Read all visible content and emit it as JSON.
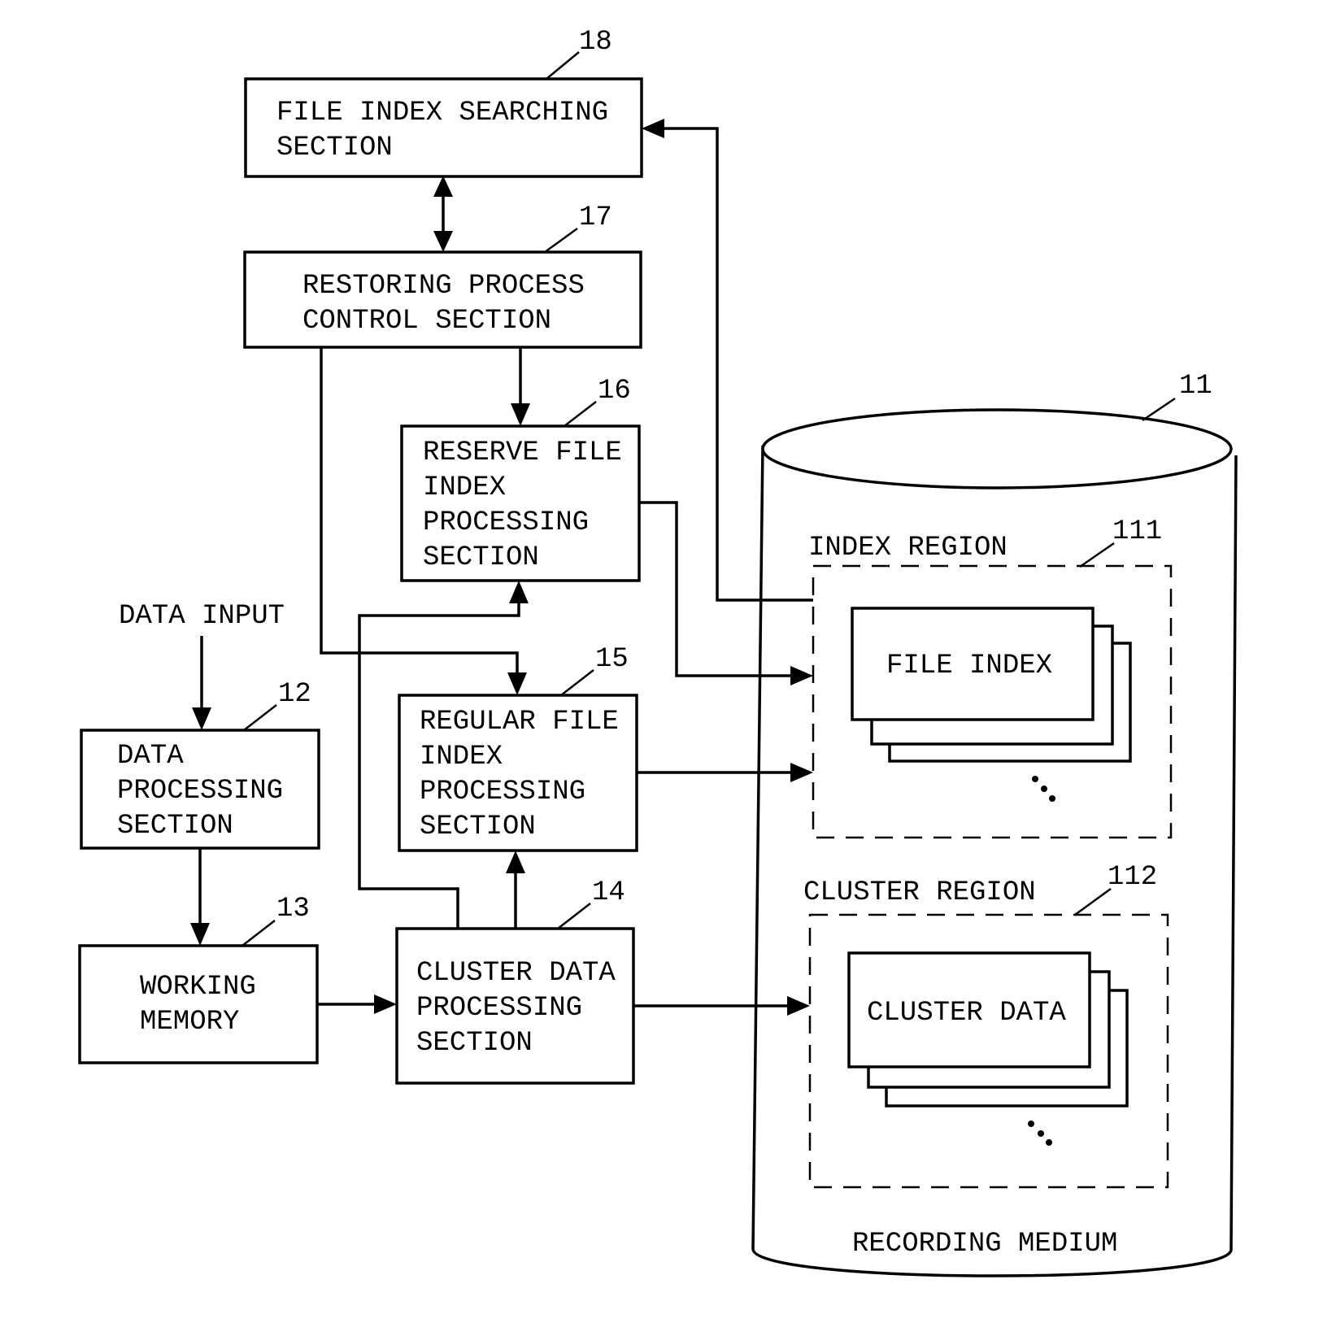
{
  "diagram": {
    "blocks": {
      "file_index_searching": {
        "ref": "18",
        "lines": [
          "FILE INDEX SEARCHING",
          "SECTION"
        ]
      },
      "restoring_process_control": {
        "ref": "17",
        "lines": [
          "RESTORING PROCESS",
          "CONTROL SECTION"
        ]
      },
      "reserve_file_index_processing": {
        "ref": "16",
        "lines": [
          "RESERVE FILE",
          "INDEX",
          "PROCESSING",
          "SECTION"
        ]
      },
      "regular_file_index_processing": {
        "ref": "15",
        "lines": [
          "REGULAR FILE",
          "INDEX",
          "PROCESSING",
          "SECTION"
        ]
      },
      "cluster_data_processing": {
        "ref": "14",
        "lines": [
          "CLUSTER DATA",
          "PROCESSING",
          "SECTION"
        ]
      },
      "data_processing": {
        "ref": "12",
        "lines": [
          "DATA",
          "PROCESSING",
          "SECTION"
        ]
      },
      "working_memory": {
        "ref": "13",
        "lines": [
          "WORKING",
          "MEMORY"
        ]
      }
    },
    "data_input_label": "DATA INPUT",
    "recording_medium": {
      "ref": "11",
      "label": "RECORDING MEDIUM",
      "index_region": {
        "ref": "111",
        "label": "INDEX REGION",
        "item": "FILE INDEX",
        "ellipsis": "..."
      },
      "cluster_region": {
        "ref": "112",
        "label": "CLUSTER REGION",
        "item": "CLUSTER DATA",
        "ellipsis": "..."
      }
    },
    "connections": [
      {
        "from": "file_index_searching",
        "to": "restoring_process_control",
        "type": "bidirectional"
      },
      {
        "from": "restoring_process_control",
        "to": "reserve_file_index_processing"
      },
      {
        "from": "restoring_process_control",
        "to": "regular_file_index_processing"
      },
      {
        "from": "cluster_data_processing",
        "to": "regular_file_index_processing"
      },
      {
        "from": "cluster_data_processing",
        "to": "reserve_file_index_processing"
      },
      {
        "from": "data_input",
        "to": "data_processing"
      },
      {
        "from": "data_processing",
        "to": "working_memory"
      },
      {
        "from": "working_memory",
        "to": "cluster_data_processing"
      },
      {
        "from": "reserve_file_index_processing",
        "to": "index_region"
      },
      {
        "from": "regular_file_index_processing",
        "to": "index_region"
      },
      {
        "from": "cluster_data_processing",
        "to": "cluster_region"
      },
      {
        "from": "index_region",
        "to": "file_index_searching"
      }
    ]
  }
}
